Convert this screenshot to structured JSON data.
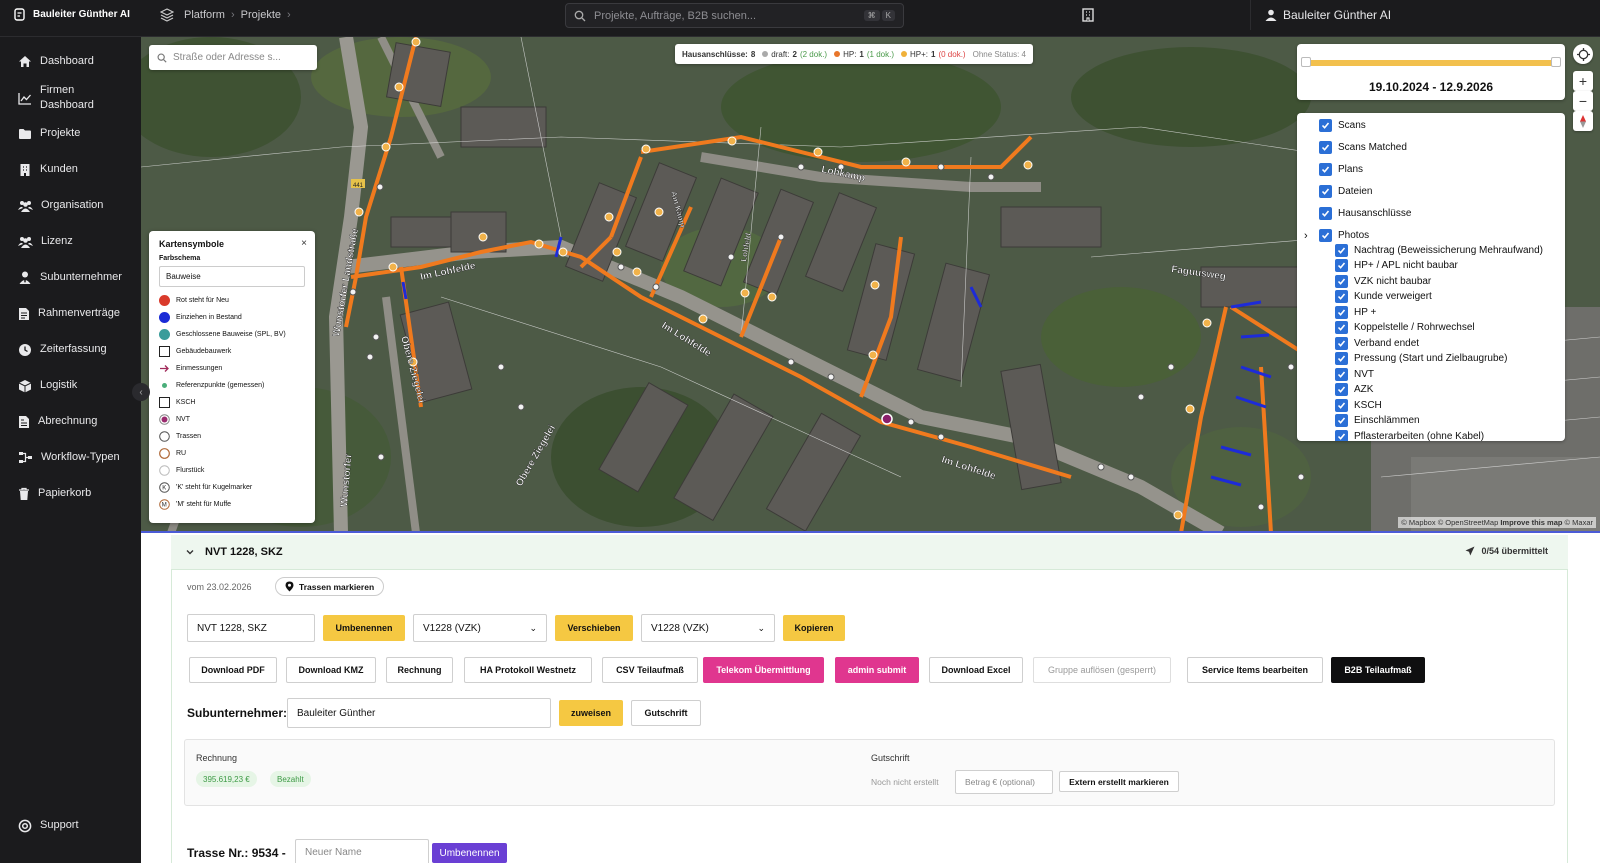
{
  "app": {
    "brand": "Bauleiter Günther AI",
    "user": "Bauleiter Günther AI"
  },
  "breadcrumb": [
    "Platform",
    "Projekte"
  ],
  "search": {
    "placeholder": "Projekte, Aufträge, B2B suchen...",
    "shortcut": [
      "⌘",
      "K"
    ]
  },
  "sidebar": {
    "items": [
      {
        "label": "Dashboard",
        "icon": "home-icon"
      },
      {
        "label": "Firmen Dashboard",
        "icon": "chart-line-icon"
      },
      {
        "label": "Projekte",
        "icon": "folder-icon"
      },
      {
        "label": "Kunden",
        "icon": "building-icon"
      },
      {
        "label": "Organisation",
        "icon": "users-icon"
      },
      {
        "label": "Lizenz",
        "icon": "users-icon"
      },
      {
        "label": "Subunternehmer",
        "icon": "user-tie-icon"
      },
      {
        "label": "Rahmenverträge",
        "icon": "document-icon"
      },
      {
        "label": "Zeiterfassung",
        "icon": "clock-icon"
      },
      {
        "label": "Logistik",
        "icon": "box-icon"
      },
      {
        "label": "Abrechnung",
        "icon": "invoice-icon"
      },
      {
        "label": "Workflow-Typen",
        "icon": "workflow-icon"
      },
      {
        "label": "Papierkorb",
        "icon": "trash-icon"
      }
    ],
    "support": "Support"
  },
  "map": {
    "address_placeholder": "Straße oder Adresse s...",
    "status": {
      "label": "Hausanschlüsse:",
      "total": "8",
      "draft_label": "draft:",
      "draft": "2",
      "draft_doc": "(2 dok.)",
      "hp_label": "HP:",
      "hp": "1",
      "hp_doc": "(1 dok.)",
      "hpplus_label": "HP+:",
      "hpplus": "1",
      "hpplus_doc": "(0 dok.)",
      "none_label": "Ohne Status: 4"
    },
    "date_range": "19.10.2024 - 12.9.2026",
    "street_labels": [
      "Im Lohfelde",
      "Im Lohfelde",
      "Im Lohfelde",
      "Lohkamp",
      "Wunstorfer Landstraße",
      "Wunstorfer",
      "Obere Ziegelei",
      "Obere Ziegelei",
      "Faguusweg",
      "Am Kamp",
      "Lohfeld",
      "441"
    ],
    "attribution": [
      "© Mapbox",
      "© OpenStreetMap",
      "Improve this map",
      "© Maxar"
    ],
    "legend": {
      "title": "Kartensymbole",
      "scheme_label": "Farbschema",
      "scheme_value": "Bauweise",
      "items": [
        {
          "label": "Rot steht für Neu",
          "color": "#d93a2b"
        },
        {
          "label": "Einziehen in Bestand",
          "color": "#1a2bd6"
        },
        {
          "label": "Geschlossene Bauweise (SPL, BV)",
          "color": "#3a9c9a"
        },
        {
          "label": "Gebäudebauwerk"
        },
        {
          "label": "Einmessungen"
        },
        {
          "label": "Referenzpunkte (gemessen)"
        },
        {
          "label": "KSCH"
        },
        {
          "label": "NVT"
        },
        {
          "label": "Trassen"
        },
        {
          "label": "RU"
        },
        {
          "label": "Flurstück"
        },
        {
          "label": "'K' steht für Kugelmarker"
        },
        {
          "label": "'M' steht für Muffe"
        }
      ]
    },
    "layers": [
      "Scans",
      "Scans Matched",
      "Plans",
      "Dateien",
      "Hausanschlüsse",
      "Photos",
      "Nachtrag (Beweissicherung Mehraufwand)",
      "HP+ / APL nicht baubar",
      "VZK nicht baubar",
      "Kunde verweigert",
      "HP +",
      "Koppelstelle / Rohrwechsel",
      "Verband endet",
      "Pressung (Start und Zielbaugrube)",
      "NVT",
      "AZK",
      "KSCH",
      "Einschlämmen",
      "Pflasterarbeiten (ohne Kabel)"
    ]
  },
  "group": {
    "title": "NVT 1228, SKZ",
    "sent": "0/54 übermittelt",
    "date": "vom 23.02.2026",
    "mark_traces": "Trassen markieren",
    "name_value": "NVT 1228, SKZ",
    "rename": "Umbenennen",
    "select1": "V1228 (VZK)",
    "move": "Verschieben",
    "select2": "V1228 (VZK)",
    "copy": "Kopieren",
    "actions": [
      "Download PDF",
      "Download KMZ",
      "Rechnung",
      "HA Protokoll Westnetz",
      "CSV Teilaufmaß",
      "Telekom Übermittlung",
      "admin submit",
      "Download Excel",
      "Gruppe auflösen (gesperrt)",
      "Service Items bearbeiten",
      "B2B Teilaufmaß"
    ],
    "sub_label": "Subunternehmer:",
    "sub_value": "Bauleiter Günther",
    "assign": "zuweisen",
    "credit_btn": "Gutschrift",
    "invoice_label": "Rechnung",
    "invoice_amount": "395.619,23 €",
    "invoice_status": "Bezahlt",
    "credit_label": "Gutschrift",
    "credit_status": "Noch nicht erstellt",
    "amount_placeholder": "Betrag € (optional)",
    "extern_btn": "Extern erstellt markieren",
    "trasse_label": "Trasse Nr.: 9534 -",
    "trasse_placeholder": "Neuer Name",
    "trasse_rename": "Umbenennen"
  }
}
